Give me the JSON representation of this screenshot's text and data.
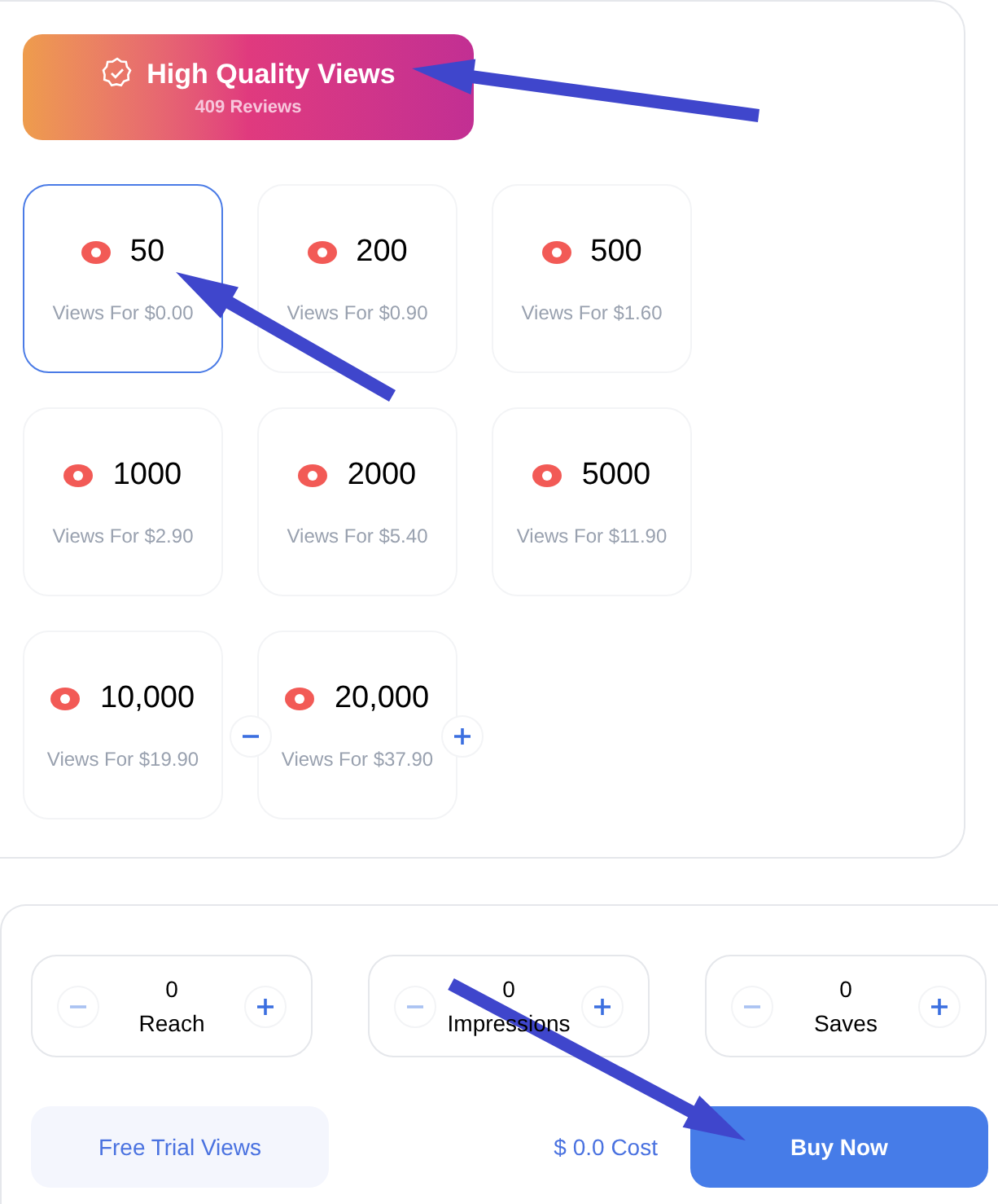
{
  "banner": {
    "title": "High Quality Views",
    "subtitle": "409 Reviews"
  },
  "packages": [
    {
      "amount": "50",
      "price": "Views For $0.00",
      "selected": true
    },
    {
      "amount": "200",
      "price": "Views For $0.90",
      "selected": false
    },
    {
      "amount": "500",
      "price": "Views For $1.60",
      "selected": false
    },
    {
      "amount": "1000",
      "price": "Views For $2.90",
      "selected": false
    },
    {
      "amount": "2000",
      "price": "Views For $5.40",
      "selected": false
    },
    {
      "amount": "5000",
      "price": "Views For $11.90",
      "selected": false
    },
    {
      "amount": "10,000",
      "price": "Views For $19.90",
      "selected": false
    },
    {
      "amount": "20,000",
      "price": "Views For $37.90",
      "selected": false
    }
  ],
  "counters": [
    {
      "value": "0",
      "label": "Reach",
      "minus_disabled": true
    },
    {
      "value": "0",
      "label": "Impressions",
      "minus_disabled": true
    },
    {
      "value": "0",
      "label": "Saves",
      "minus_disabled": true
    }
  ],
  "free_trial_button": "Free Trial Views",
  "cost": "$ 0.0 Cost",
  "buy_button": "Buy Now"
}
